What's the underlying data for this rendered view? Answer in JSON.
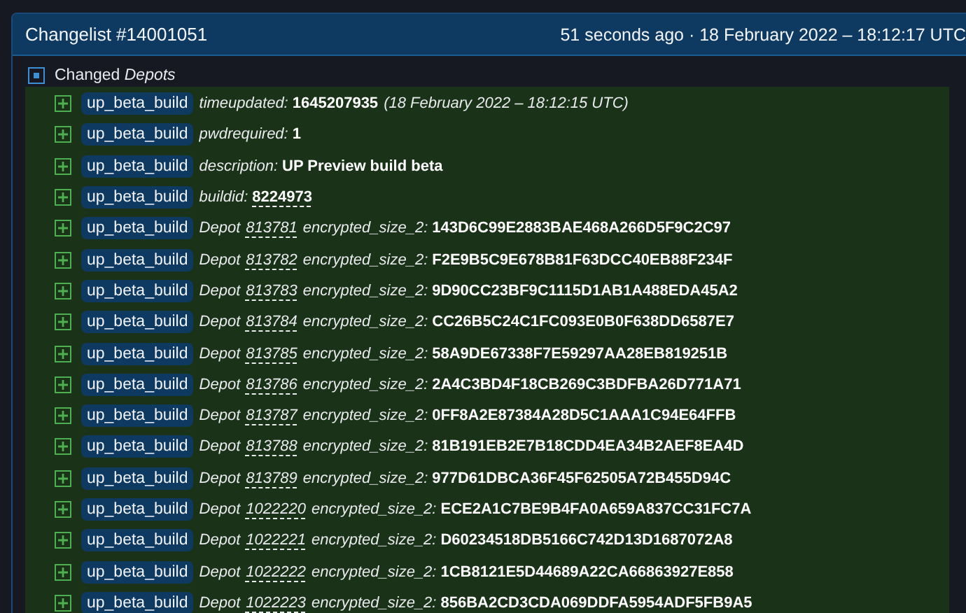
{
  "header": {
    "title": "Changelist #14001051",
    "time": "51 seconds ago · 18 February 2022 – 18:12:17 UTC"
  },
  "section": {
    "label": "Changed *Depots*",
    "expanded": true
  },
  "rows": [
    {
      "tag": "up_beta_build",
      "key": "timeupdated:",
      "value": "1645207935",
      "linked": false,
      "note": "(18 February 2022 – 18:12:15 UTC)"
    },
    {
      "tag": "up_beta_build",
      "key": "pwdrequired:",
      "value": "1",
      "linked": false
    },
    {
      "tag": "up_beta_build",
      "key": "description:",
      "value": "UP Preview build beta",
      "linked": false
    },
    {
      "tag": "up_beta_build",
      "key": "buildid:",
      "value": "8224973",
      "linked": true
    },
    {
      "tag": "up_beta_build",
      "prefix": "Depot",
      "depot": "813781",
      "key": "encrypted_size_2:",
      "value": "143D6C99E2883BAE468A266D5F9C2C97",
      "linked": false
    },
    {
      "tag": "up_beta_build",
      "prefix": "Depot",
      "depot": "813782",
      "key": "encrypted_size_2:",
      "value": "F2E9B5C9E678B81F63DCC40EB88F234F",
      "linked": false
    },
    {
      "tag": "up_beta_build",
      "prefix": "Depot",
      "depot": "813783",
      "key": "encrypted_size_2:",
      "value": "9D90CC23BF9C1115D1AB1A488EDA45A2",
      "linked": false
    },
    {
      "tag": "up_beta_build",
      "prefix": "Depot",
      "depot": "813784",
      "key": "encrypted_size_2:",
      "value": "CC26B5C24C1FC093E0B0F638DD6587E7",
      "linked": false
    },
    {
      "tag": "up_beta_build",
      "prefix": "Depot",
      "depot": "813785",
      "key": "encrypted_size_2:",
      "value": "58A9DE67338F7E59297AA28EB819251B",
      "linked": false
    },
    {
      "tag": "up_beta_build",
      "prefix": "Depot",
      "depot": "813786",
      "key": "encrypted_size_2:",
      "value": "2A4C3BD4F18CB269C3BDFBA26D771A71",
      "linked": false
    },
    {
      "tag": "up_beta_build",
      "prefix": "Depot",
      "depot": "813787",
      "key": "encrypted_size_2:",
      "value": "0FF8A2E87384A28D5C1AAA1C94E64FFB",
      "linked": false
    },
    {
      "tag": "up_beta_build",
      "prefix": "Depot",
      "depot": "813788",
      "key": "encrypted_size_2:",
      "value": "81B191EB2E7B18CDD4EA34B2AEF8EA4D",
      "linked": false
    },
    {
      "tag": "up_beta_build",
      "prefix": "Depot",
      "depot": "813789",
      "key": "encrypted_size_2:",
      "value": "977D61DBCA36F45F62505A72B455D94C",
      "linked": false
    },
    {
      "tag": "up_beta_build",
      "prefix": "Depot",
      "depot": "1022220",
      "key": "encrypted_size_2:",
      "value": "ECE2A1C7BE9B4FA0A659A837CC31FC7A",
      "linked": false
    },
    {
      "tag": "up_beta_build",
      "prefix": "Depot",
      "depot": "1022221",
      "key": "encrypted_size_2:",
      "value": "D60234518DB5166C742D13D1687072A8",
      "linked": false
    },
    {
      "tag": "up_beta_build",
      "prefix": "Depot",
      "depot": "1022222",
      "key": "encrypted_size_2:",
      "value": "1CB8121E5D44689A22CA66863927E858",
      "linked": false
    },
    {
      "tag": "up_beta_build",
      "prefix": "Depot",
      "depot": "1022223",
      "key": "encrypted_size_2:",
      "value": "856BA2CD3CDA069DDFA5954ADF5FB9A5",
      "linked": false
    }
  ]
}
